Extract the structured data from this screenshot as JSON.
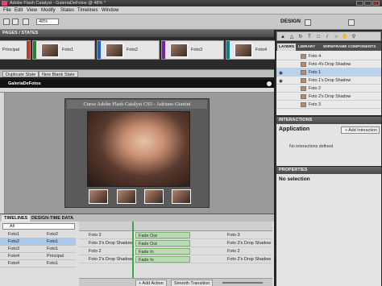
{
  "window": {
    "title": "Adobe Flash Catalyst - GaleriaDeFotos @ 48% *"
  },
  "menu": [
    "File",
    "Edit",
    "View",
    "Modify",
    "States",
    "Timelines",
    "Window"
  ],
  "toolbar": {
    "zoom": "48%",
    "workspace": "DESIGN"
  },
  "states_panel": {
    "header": "PAGES / STATES",
    "states": [
      {
        "label": "Principal",
        "accent": "#c0392b"
      },
      {
        "label": "Foto1",
        "accent": "#2e7d32"
      },
      {
        "label": "Foto2",
        "accent": "#1565c0"
      },
      {
        "label": "Foto3",
        "accent": "#7b1fa2"
      },
      {
        "label": "Foto4",
        "accent": "#00838f"
      }
    ],
    "duplicate_state": "Duplicate State",
    "new_blank_state": "New Blank State"
  },
  "breadcrumb": "GaleriaDeFotos",
  "artboard": {
    "title": "Curso Adobe Flash Catalyst CS5 - Adriano Gianini"
  },
  "timelines": {
    "tabs": [
      "TIMELINES",
      "DESIGN-TIME DATA"
    ],
    "filter": "All",
    "rows": [
      {
        "from": "Foto1",
        "to": "Foto2",
        "selected": false
      },
      {
        "from": "Foto2",
        "to": "Foto1",
        "selected": true
      },
      {
        "from": "Foto3",
        "to": "Foto1",
        "selected": false
      },
      {
        "from": "Foto4",
        "to": "Principal",
        "selected": false
      },
      {
        "from": "Foto4",
        "to": "Foto1",
        "selected": false
      }
    ],
    "tracks": [
      {
        "name": "Foto 3",
        "effect": "Fade Out"
      },
      {
        "name": "Foto 3's Drop Shadow",
        "effect": "Fade Out"
      },
      {
        "name": "Foto 2",
        "effect": "Fade In"
      },
      {
        "name": "Foto 2's Drop Shadow",
        "effect": "Fade In"
      }
    ],
    "right_tracks": [
      "Foto 3",
      "Foto 3's Drop Shadow",
      "Foto 2",
      "Foto 2's Drop Shadow"
    ],
    "add_action": "+ Add Action",
    "smooth_transition": "Smooth Transition"
  },
  "right_panel": {
    "layer_tabs": [
      "LAYERS",
      "LIBRARY",
      "WIREFRAME COMPONENTS"
    ],
    "layers": [
      {
        "name": "Foto 4",
        "visible": false,
        "selected": false
      },
      {
        "name": "Foto 4's Drop Shadow",
        "visible": false,
        "selected": false
      },
      {
        "name": "Foto 1",
        "visible": true,
        "selected": true
      },
      {
        "name": "Foto 1's Drop Shadow",
        "visible": true,
        "selected": false
      },
      {
        "name": "Foto 2",
        "visible": false,
        "selected": false
      },
      {
        "name": "Foto 2's Drop Shadow",
        "visible": false,
        "selected": false
      },
      {
        "name": "Foto 3",
        "visible": false,
        "selected": false
      }
    ],
    "interactions": {
      "header": "INTERACTIONS",
      "scope": "Application",
      "add_button": "+ Add Interaction",
      "empty": "No interactions defined"
    },
    "properties": {
      "header": "PROPERTIES",
      "empty": "No selection"
    }
  }
}
